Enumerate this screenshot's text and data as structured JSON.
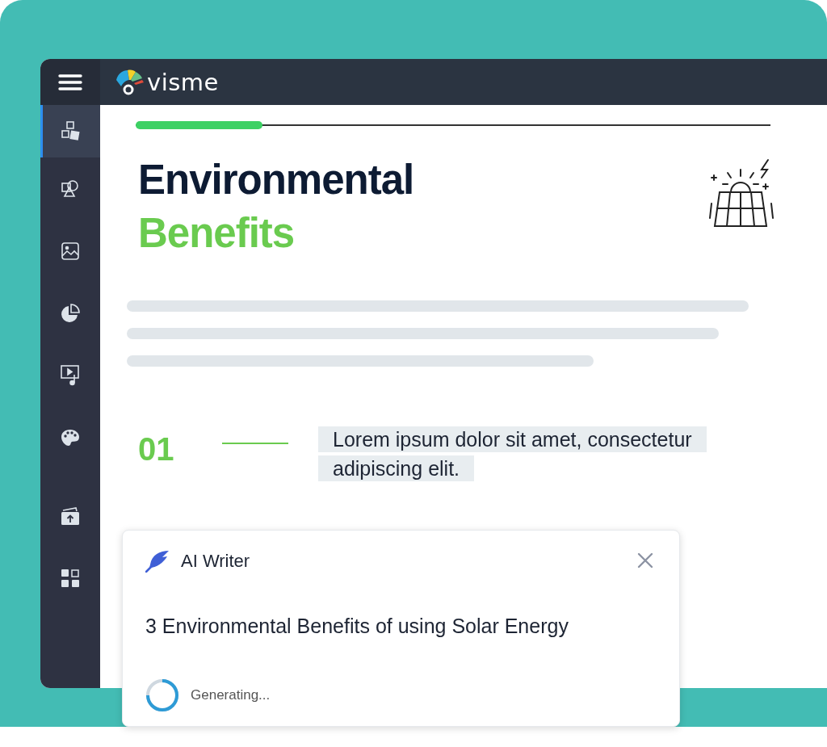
{
  "topbar": {
    "logo_text": "visme"
  },
  "sidebar": {
    "items": [
      {
        "selected": true
      },
      {
        "selected": false
      },
      {
        "selected": false
      },
      {
        "selected": false
      },
      {
        "selected": false
      },
      {
        "selected": false
      },
      {
        "selected": false
      },
      {
        "selected": false
      }
    ]
  },
  "slide": {
    "progress": {
      "level": 0.2
    },
    "title_line_1": "Environmental",
    "title_line_2": "Benefits",
    "item_number": "01",
    "item_text": "Lorem ipsum dolor sit amet,  consectetur adipiscing elit."
  },
  "ai_writer": {
    "title": "AI Writer",
    "prompt": "3 Environmental Benefits of using Solar Energy",
    "status": "Generating..."
  }
}
